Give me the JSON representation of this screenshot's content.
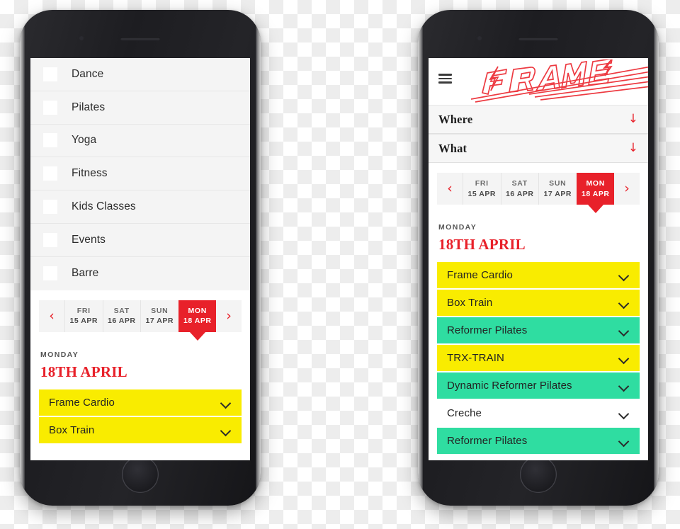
{
  "meta": {
    "colors": {
      "red": "#e8212a",
      "yellow": "#f9ec00",
      "green": "#2fdda1",
      "light_gray": "#f4f4f4"
    }
  },
  "left_phone": {
    "screen": {
      "filters": {
        "items": [
          {
            "label": "Dance",
            "checked": false
          },
          {
            "label": "Pilates",
            "checked": false
          },
          {
            "label": "Yoga",
            "checked": false
          },
          {
            "label": "Fitness",
            "checked": false
          },
          {
            "label": "Kids Classes",
            "checked": false
          },
          {
            "label": "Events",
            "checked": false
          },
          {
            "label": "Barre",
            "checked": false
          }
        ]
      },
      "date_picker": {
        "prev_icon": "chevron-left-icon",
        "next_icon": "chevron-right-icon",
        "prev_glyph": "‹",
        "next_glyph": "›",
        "days": [
          {
            "dow": "FRI",
            "date": "15 APR",
            "active": false
          },
          {
            "dow": "SAT",
            "date": "16 APR",
            "active": false
          },
          {
            "dow": "SUN",
            "date": "17 APR",
            "active": false
          },
          {
            "dow": "MON",
            "date": "18 APR",
            "active": true
          }
        ]
      },
      "day_heading": {
        "weekday": "MONDAY",
        "date": "18TH APRIL"
      },
      "classes": [
        {
          "name": "Frame Cardio",
          "color": "yellow"
        },
        {
          "name": "Box Train",
          "color": "yellow"
        }
      ]
    }
  },
  "right_phone": {
    "screen": {
      "header": {
        "menu_icon": "hamburger-menu-icon",
        "logo_text": "FRAME",
        "logo_name": "frame-logo"
      },
      "accordions": [
        {
          "label": "Where",
          "arrow_glyph": "↓",
          "arrow_icon": "arrow-down-icon"
        },
        {
          "label": "What",
          "arrow_glyph": "↓",
          "arrow_icon": "arrow-down-icon"
        }
      ],
      "date_picker": {
        "prev_icon": "chevron-left-icon",
        "next_icon": "chevron-right-icon",
        "prev_glyph": "‹",
        "next_glyph": "›",
        "days": [
          {
            "dow": "FRI",
            "date": "15 APR",
            "active": false
          },
          {
            "dow": "SAT",
            "date": "16 APR",
            "active": false
          },
          {
            "dow": "SUN",
            "date": "17 APR",
            "active": false
          },
          {
            "dow": "MON",
            "date": "18 APR",
            "active": true
          }
        ]
      },
      "day_heading": {
        "weekday": "MONDAY",
        "date": "18TH APRIL"
      },
      "classes": [
        {
          "name": "Frame Cardio",
          "color": "yellow"
        },
        {
          "name": "Box Train",
          "color": "yellow"
        },
        {
          "name": "Reformer Pilates",
          "color": "green"
        },
        {
          "name": "TRX-TRAIN",
          "color": "yellow"
        },
        {
          "name": "Dynamic Reformer Pilates",
          "color": "green"
        },
        {
          "name": "Creche",
          "color": "white"
        },
        {
          "name": "Reformer Pilates",
          "color": "green"
        }
      ]
    }
  }
}
